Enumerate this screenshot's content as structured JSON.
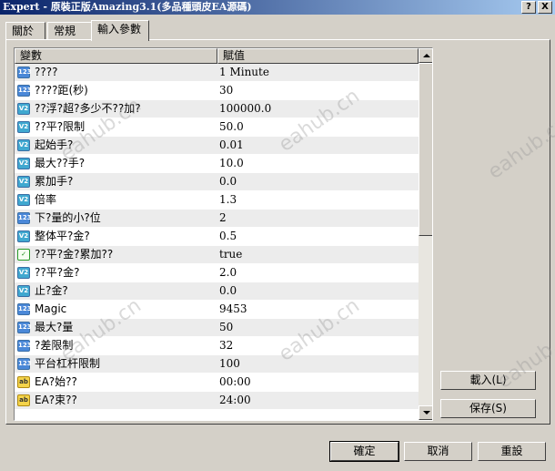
{
  "window": {
    "title": "Expert - 原裝正版Amazing3.1(多品種頭皮EA源碼)",
    "help_label": "?",
    "close_label": "X"
  },
  "tabs": [
    {
      "label": "關於",
      "active": false
    },
    {
      "label": "常規",
      "active": false
    },
    {
      "label": "輸入參數",
      "active": true
    }
  ],
  "table": {
    "headers": [
      "變數",
      "賦值"
    ],
    "rows": [
      {
        "icon": "int",
        "icon_text": "123",
        "name": "????",
        "value": "1 Minute"
      },
      {
        "icon": "int",
        "icon_text": "123",
        "name": "????距(秒)",
        "value": "30"
      },
      {
        "icon": "dbl",
        "icon_text": "V2",
        "name": "??浮?超?多少不??加?",
        "value": "100000.0"
      },
      {
        "icon": "dbl",
        "icon_text": "V2",
        "name": "??平?限制",
        "value": "50.0"
      },
      {
        "icon": "dbl",
        "icon_text": "V2",
        "name": "起始手?",
        "value": "0.01"
      },
      {
        "icon": "dbl",
        "icon_text": "V2",
        "name": "最大??手?",
        "value": "10.0"
      },
      {
        "icon": "dbl",
        "icon_text": "V2",
        "name": "累加手?",
        "value": "0.0"
      },
      {
        "icon": "dbl",
        "icon_text": "V2",
        "name": "倍率",
        "value": "1.3"
      },
      {
        "icon": "int",
        "icon_text": "123",
        "name": "下?量的小?位",
        "value": "2"
      },
      {
        "icon": "dbl",
        "icon_text": "V2",
        "name": "整体平?金?",
        "value": "0.5"
      },
      {
        "icon": "bool",
        "icon_text": "✓",
        "name": "??平?金?累加??",
        "value": "true"
      },
      {
        "icon": "dbl",
        "icon_text": "V2",
        "name": "??平?金?",
        "value": "2.0"
      },
      {
        "icon": "dbl",
        "icon_text": "V2",
        "name": "止?金?",
        "value": "0.0"
      },
      {
        "icon": "int",
        "icon_text": "123",
        "name": "Magic",
        "value": "9453"
      },
      {
        "icon": "int",
        "icon_text": "123",
        "name": "最大?量",
        "value": "50"
      },
      {
        "icon": "int",
        "icon_text": "123",
        "name": "?差限制",
        "value": "32"
      },
      {
        "icon": "int",
        "icon_text": "123",
        "name": "平台杠杆限制",
        "value": "100"
      },
      {
        "icon": "str",
        "icon_text": "ab",
        "name": "EA?始??",
        "value": "00:00"
      },
      {
        "icon": "str",
        "icon_text": "ab",
        "name": "EA?束??",
        "value": "24:00"
      }
    ]
  },
  "side_buttons": {
    "load_label": "載入(L)",
    "save_label": "保存(S)"
  },
  "footer_buttons": {
    "ok_label": "確定",
    "cancel_label": "取消",
    "reset_label": "重設"
  },
  "watermarks": [
    "eahub.cn",
    "eahub.cn",
    "eahub.cn",
    "eahub.cn",
    "eahub.cn",
    "eahub.cn"
  ]
}
